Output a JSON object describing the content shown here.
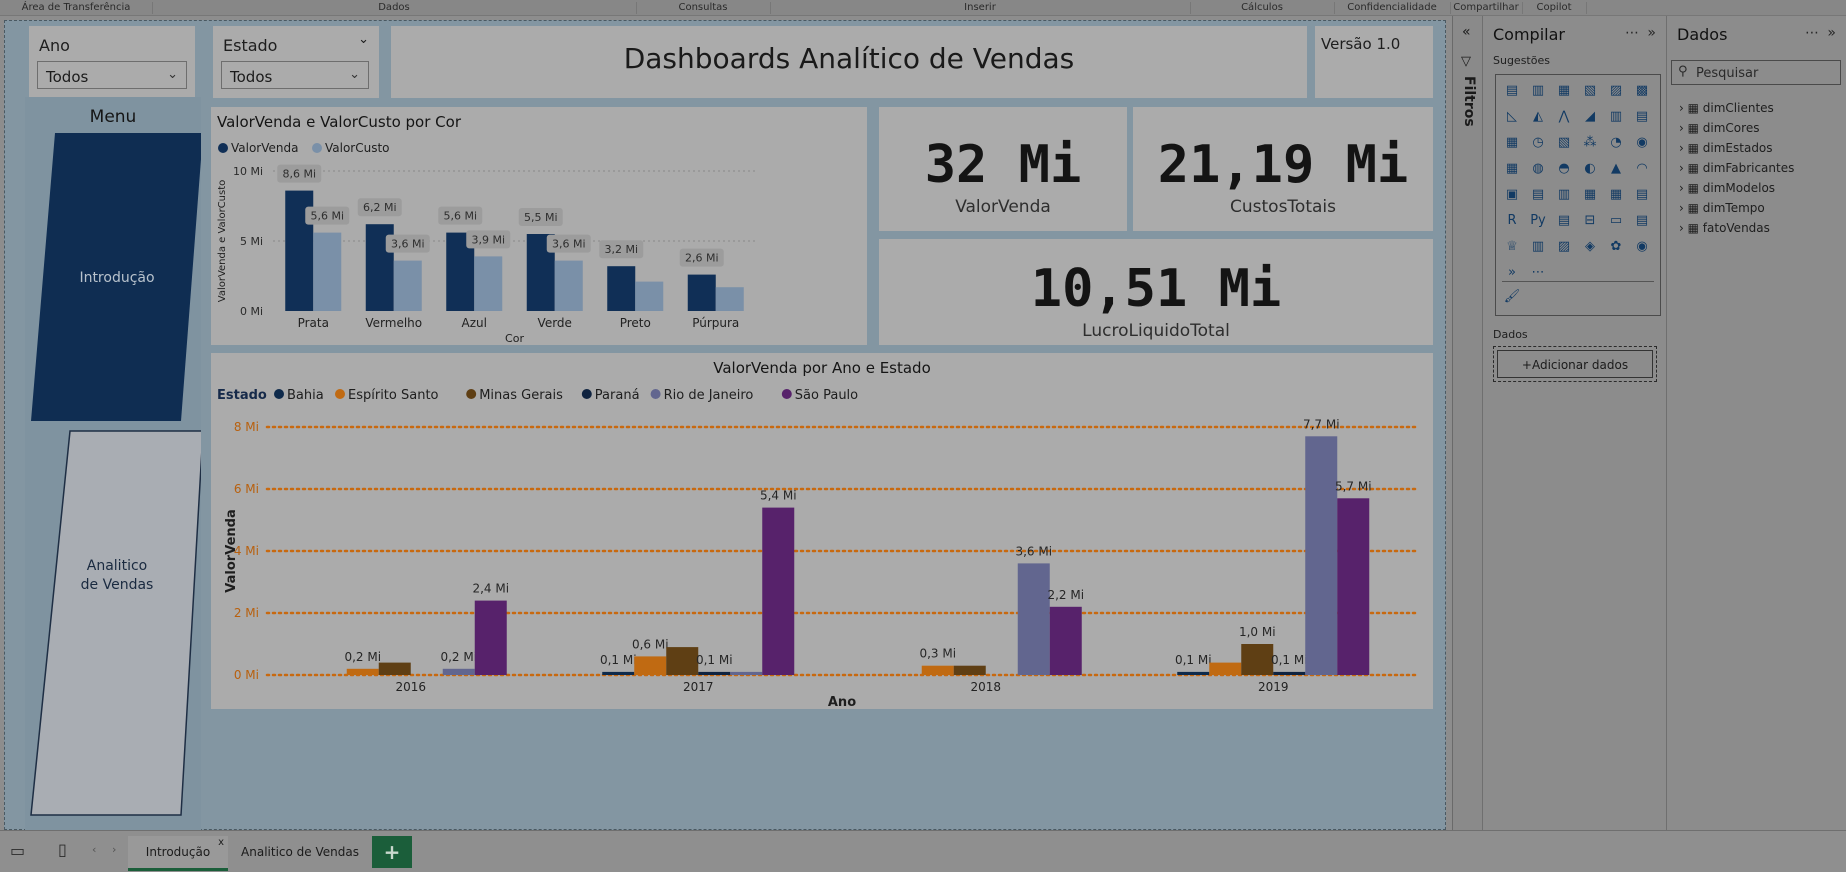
{
  "ribbon": {
    "groups": [
      "Área de Transferência",
      "Dados",
      "Consultas",
      "Inserir",
      "Cálculos",
      "Confidencialidade",
      "Compartilhar",
      "Copilot"
    ]
  },
  "slicers": {
    "ano": {
      "title": "Ano",
      "value": "Todos"
    },
    "estado": {
      "title": "Estado",
      "value": "Todos"
    }
  },
  "header": {
    "title": "Dashboards Analítico de Vendas",
    "version": "Versão 1.0"
  },
  "menu": {
    "title": "Menu",
    "btn_intro": "Introdução",
    "btn_analitico_1": "Analitico",
    "btn_analitico_2": "de Vendas"
  },
  "kpis": {
    "valor_venda": {
      "value": "32 Mi",
      "label": "ValorVenda"
    },
    "custos": {
      "value": "21,19 Mi",
      "label": "CustosTotais"
    },
    "lucro": {
      "value": "10,51 Mi",
      "label": "LucroLiquidoTotal"
    }
  },
  "chart_data": [
    {
      "type": "bar",
      "title": "ValorVenda e ValorCusto por Cor",
      "xlabel": "Cor",
      "ylabel": "ValorVenda e ValorCusto",
      "ylim": [
        0,
        10
      ],
      "yticks": [
        "0 Mi",
        "5 Mi",
        "10 Mi"
      ],
      "categories": [
        "Prata",
        "Vermelho",
        "Azul",
        "Verde",
        "Preto",
        "Púrpura"
      ],
      "series": [
        {
          "name": "ValorVenda",
          "color": "#102f56",
          "values": [
            8.6,
            6.2,
            5.6,
            5.5,
            3.2,
            2.6
          ],
          "labels": [
            "8,6 Mi",
            "6,2 Mi",
            "5,6 Mi",
            "5,5 Mi",
            "3,2 Mi",
            "2,6 Mi"
          ]
        },
        {
          "name": "ValorCusto",
          "color": "#7a90a8",
          "values": [
            5.6,
            3.6,
            3.9,
            3.6,
            2.1,
            1.7
          ],
          "labels": [
            "5,6 Mi",
            "3,6 Mi",
            "3,9 Mi",
            "3,6 Mi",
            "",
            ""
          ]
        }
      ],
      "legend": "top-left"
    },
    {
      "type": "bar",
      "title": "ValorVenda por Ano e Estado",
      "legend_title": "Estado",
      "xlabel": "Ano",
      "ylabel": "ValorVenda",
      "ylim": [
        0,
        8
      ],
      "yticks": [
        "0 Mi",
        "2 Mi",
        "4 Mi",
        "6 Mi",
        "8 Mi"
      ],
      "categories": [
        "2016",
        "2017",
        "2018",
        "2019"
      ],
      "series": [
        {
          "name": "Bahia",
          "color": "#0e2a4b",
          "values": [
            0,
            0.1,
            0,
            0.1
          ],
          "labels": [
            "",
            "0,1 Mi",
            "",
            "0,1 Mi"
          ]
        },
        {
          "name": "Espírito Santo",
          "color": "#c06a12",
          "values": [
            0.2,
            0.6,
            0.3,
            0.4
          ],
          "labels": [
            "0,2 Mi",
            "0,6 Mi",
            "0,3 Mi",
            ""
          ]
        },
        {
          "name": "Minas Gerais",
          "color": "#5f3f14",
          "values": [
            0.4,
            0.9,
            0.3,
            1.0
          ],
          "labels": [
            "",
            "",
            "",
            "1,0 Mi"
          ]
        },
        {
          "name": "Paraná",
          "color": "#0f2340",
          "values": [
            0,
            0.1,
            0,
            0.1
          ],
          "labels": [
            "",
            "0,1 Mi",
            "",
            "0,1 Mi"
          ]
        },
        {
          "name": "Rio de Janeiro",
          "color": "#62668f",
          "values": [
            0.2,
            0.1,
            3.6,
            7.7
          ],
          "labels": [
            "0,2 Mi",
            "",
            "3,6 Mi",
            "7,7 Mi"
          ]
        },
        {
          "name": "São Paulo",
          "color": "#57226b",
          "values": [
            2.4,
            5.4,
            2.2,
            5.7
          ],
          "labels": [
            "2,4 Mi",
            "5,4 Mi",
            "2,2 Mi",
            "5,7 Mi"
          ]
        }
      ],
      "grid": true,
      "legend": "top-left"
    }
  ],
  "filtros": {
    "label": "Filtros"
  },
  "compilar": {
    "title": "Compilar",
    "sugestoes": "Sugestões",
    "dados_label": "Dados",
    "add_button": "+Adicionar dados"
  },
  "dados": {
    "title": "Dados",
    "search_placeholder": "Pesquisar",
    "tables": [
      "dimClientes",
      "dimCores",
      "dimEstados",
      "dimFabricantes",
      "dimModelos",
      "dimTempo",
      "fatoVendas"
    ]
  },
  "pages": {
    "tabs": [
      "Introdução",
      "Analitico de Vendas"
    ],
    "close": "x",
    "add": "+"
  }
}
